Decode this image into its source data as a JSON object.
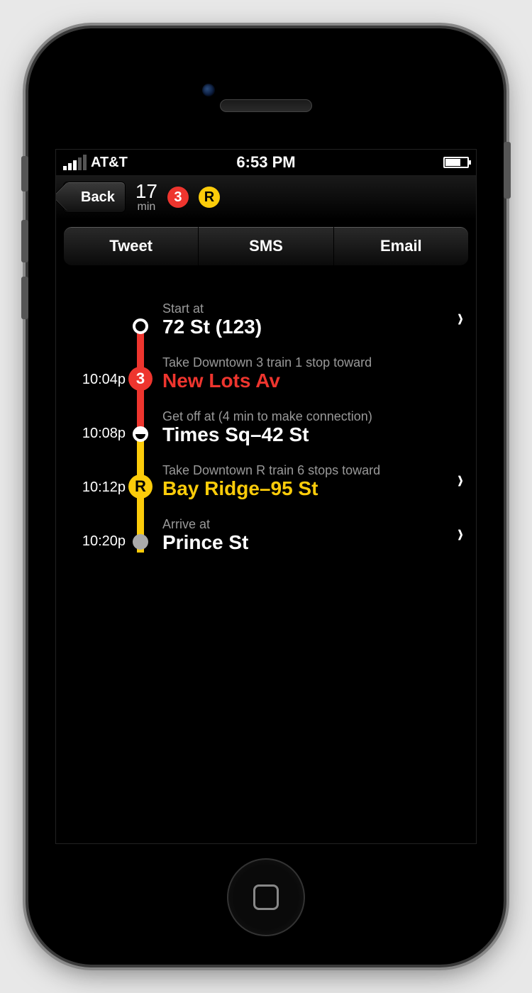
{
  "status": {
    "carrier": "AT&T",
    "time": "6:53 PM"
  },
  "nav": {
    "back_label": "Back",
    "duration_value": "17",
    "duration_unit": "min",
    "lines": [
      {
        "label": "3",
        "color": "#ee352e",
        "text_color": "#ffffff"
      },
      {
        "label": "R",
        "color": "#fccc0a",
        "text_color": "#000000"
      }
    ]
  },
  "share": {
    "tweet": "Tweet",
    "sms": "SMS",
    "email": "Email"
  },
  "steps": [
    {
      "time": "",
      "sub": "Start at",
      "main": "72 St (123)",
      "main_color": "#ffffff",
      "node": {
        "type": "hollow"
      },
      "connector_below": "#ee352e",
      "chevron": true
    },
    {
      "time": "10:04p",
      "sub": "Take Downtown 3 train 1 stop toward",
      "main": "New Lots Av",
      "main_color": "#ee352e",
      "node": {
        "type": "bullet",
        "label": "3",
        "bg": "#ee352e",
        "fg": "#ffffff"
      },
      "connector_above": "#ee352e",
      "connector_below": "#ee352e",
      "chevron": false
    },
    {
      "time": "10:08p",
      "sub": "Get off at (4 min to make connection)",
      "main": "Times Sq–42 St",
      "main_color": "#ffffff",
      "node": {
        "type": "half"
      },
      "connector_above": "#ee352e",
      "connector_below": "#fccc0a",
      "chevron": false
    },
    {
      "time": "10:12p",
      "sub": "Take Downtown R train 6 stops toward",
      "main": "Bay Ridge–95 St",
      "main_color": "#fccc0a",
      "node": {
        "type": "bullet",
        "label": "R",
        "bg": "#fccc0a",
        "fg": "#000000"
      },
      "connector_above": "#fccc0a",
      "connector_below": "#fccc0a",
      "chevron": true
    },
    {
      "time": "10:20p",
      "sub": "Arrive at",
      "main": "Prince St",
      "main_color": "#ffffff",
      "node": {
        "type": "filled"
      },
      "connector_above": "#fccc0a",
      "chevron": true
    }
  ]
}
